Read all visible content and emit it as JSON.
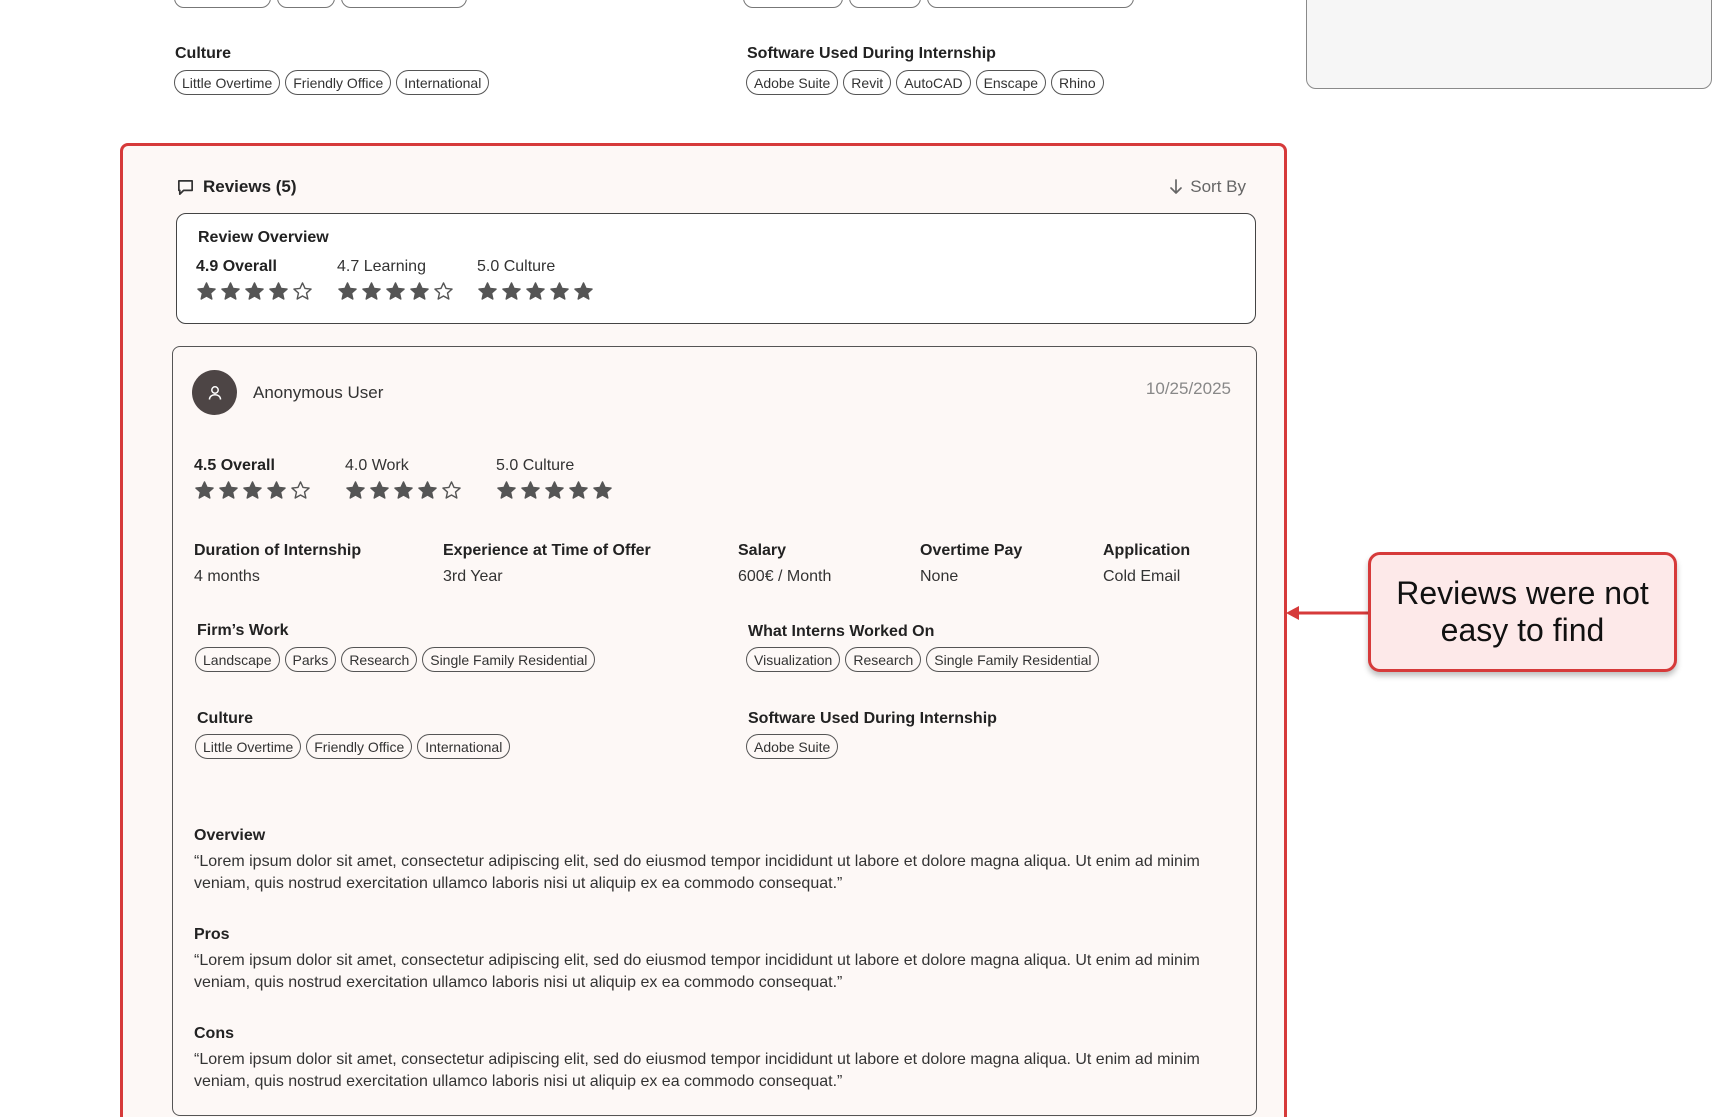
{
  "firm_details": {
    "culture_label": "Culture",
    "culture_tags": [
      "Little Overtime",
      "Friendly Office",
      "International"
    ],
    "software_label": "Software Used During Internship",
    "software_tags": [
      "Adobe Suite",
      "Revit",
      "AutoCAD",
      "Enscape",
      "Rhino"
    ]
  },
  "reviews": {
    "title": "Reviews (5)",
    "sort_label": "Sort By",
    "overview": {
      "title": "Review Overview",
      "ratings": [
        {
          "label": "4.9 Overall",
          "stars": 4
        },
        {
          "label": "4.7 Learning",
          "stars": 4
        },
        {
          "label": "5.0 Culture",
          "stars": 5
        }
      ]
    },
    "items": [
      {
        "user": "Anonymous User",
        "date": "10/25/2025",
        "ratings": [
          {
            "label": "4.5 Overall",
            "stars": 4
          },
          {
            "label": "4.0 Work",
            "stars": 4
          },
          {
            "label": "5.0 Culture",
            "stars": 5
          }
        ],
        "details": [
          {
            "label": "Duration of Internship",
            "value": "4 months"
          },
          {
            "label": "Experience at Time of Offer",
            "value": "3rd Year"
          },
          {
            "label": "Salary",
            "value": "600€ / Month"
          },
          {
            "label": "Overtime Pay",
            "value": "None"
          },
          {
            "label": "Application",
            "value": "Cold Email"
          }
        ],
        "firms_work_label": "Firm’s Work",
        "firms_work_tags": [
          "Landscape",
          "Parks",
          "Research",
          "Single Family Residential"
        ],
        "interns_work_label": "What Interns Worked On",
        "interns_work_tags": [
          "Visualization",
          "Research",
          "Single Family Residential"
        ],
        "culture_label": "Culture",
        "culture_tags": [
          "Little Overtime",
          "Friendly Office",
          "International"
        ],
        "software_label": "Software Used During Internship",
        "software_tags": [
          "Adobe Suite"
        ],
        "overview_label": "Overview",
        "overview_text": "“Lorem ipsum dolor sit amet, consectetur adipiscing elit, sed do eiusmod tempor incididunt ut labore et dolore magna aliqua. Ut enim ad minim veniam, quis nostrud exercitation ullamco laboris nisi ut aliquip ex ea commodo consequat.”",
        "pros_label": "Pros",
        "pros_text": "“Lorem ipsum dolor sit amet, consectetur adipiscing elit, sed do eiusmod tempor incididunt ut labore et dolore magna aliqua. Ut enim ad minim veniam, quis nostrud exercitation ullamco laboris nisi ut aliquip ex ea commodo consequat.”",
        "cons_label": "Cons",
        "cons_text": "“Lorem ipsum dolor sit amet, consectetur adipiscing elit, sed do eiusmod tempor incididunt ut labore et dolore magna aliqua. Ut enim ad minim veniam, quis nostrud exercitation ullamco laboris nisi ut aliquip ex ea commodo consequat.”"
      }
    ]
  },
  "annotation": {
    "callout_text": "Reviews were not easy to find",
    "color": "#d63a3a"
  },
  "icons": {
    "reviews": "speech-bubble-icon",
    "sort": "arrow-down-icon",
    "avatar": "user-icon",
    "star_filled": "star-filled-icon",
    "star_empty": "star-outline-icon"
  }
}
